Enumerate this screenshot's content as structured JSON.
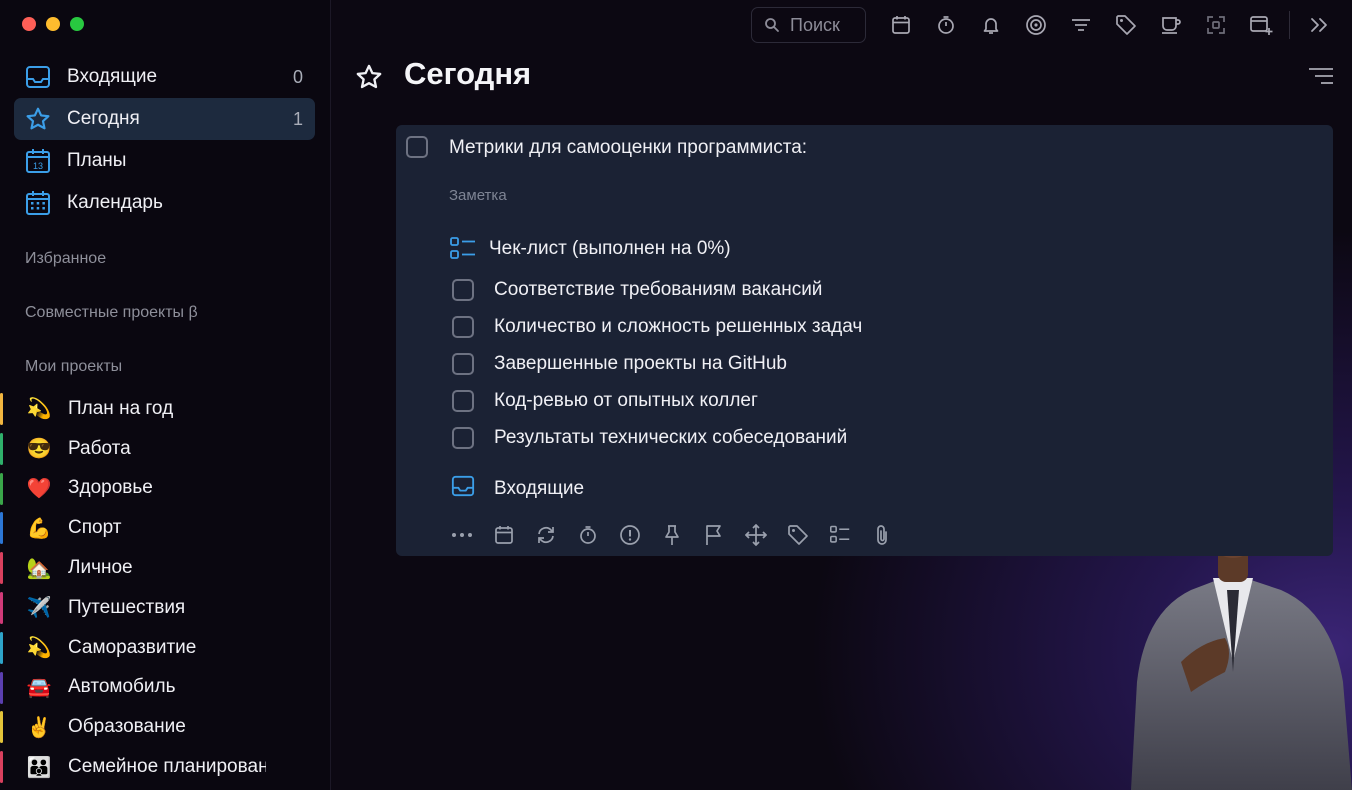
{
  "sidebar": {
    "nav": [
      {
        "label": "Входящие",
        "count": "0"
      },
      {
        "label": "Сегодня",
        "count": "1"
      },
      {
        "label": "Планы",
        "count": ""
      },
      {
        "label": "Календарь",
        "count": ""
      }
    ],
    "calendar_icon_day": "13",
    "favorites": "Избранное",
    "shared": "Совместные проекты β",
    "my_projects": "Мои проекты",
    "projects": [
      {
        "emoji": "💫",
        "label": "План на год",
        "color": "#f2b640"
      },
      {
        "emoji": "😎",
        "label": "Работа",
        "color": "#2fb06b"
      },
      {
        "emoji": "❤️",
        "label": "Здоровье",
        "color": "#3aa64a"
      },
      {
        "emoji": "💪",
        "label": "Спорт",
        "color": "#2c76d6"
      },
      {
        "emoji": "🏡",
        "label": "Личное",
        "color": "#d9405e"
      },
      {
        "emoji": "✈️",
        "label": "Путешествия",
        "color": "#d03a78"
      },
      {
        "emoji": "💫",
        "label": "Саморазвитие",
        "color": "#2ea4c9"
      },
      {
        "emoji": "🚘",
        "label": "Автомобиль",
        "color": "#5b3fb0"
      },
      {
        "emoji": "✌️",
        "label": "Образование",
        "color": "#e4c43a"
      },
      {
        "emoji": "👪",
        "label": "Семейное планирование",
        "color": "#d9405e"
      }
    ]
  },
  "toolbar": {
    "search_placeholder": "Поиск"
  },
  "main": {
    "title": "Сегодня",
    "task": {
      "title": "Метрики для самооценки программиста:",
      "note_placeholder": "Заметка",
      "checklist_title": "Чек-лист (выполнен на 0%)",
      "checklist_progress": 0,
      "checklist": [
        "Соответствие требованиям вакансий",
        "Количество и сложность решенных задач",
        "Завершенные проекты на GitHub",
        "Код-ревью от опытных коллег",
        "Результаты технических собеседований"
      ],
      "project": "Входящие"
    }
  },
  "colors": {
    "accent": "#3b9ee8",
    "active_bg": "#1d2a3e",
    "card_bg": "#1b2234"
  }
}
